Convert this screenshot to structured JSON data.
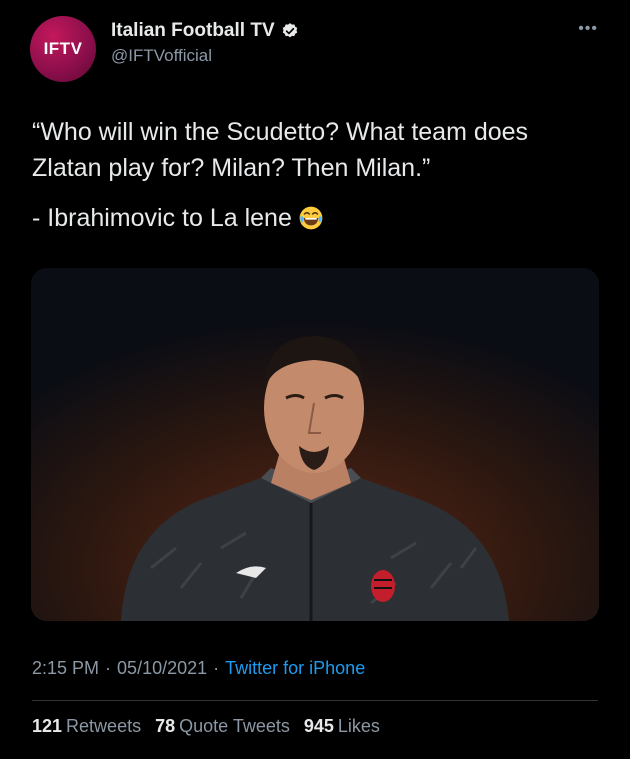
{
  "account": {
    "avatar_text": "IFTV",
    "display_name": "Italian Football TV",
    "handle": "@IFTVofficial",
    "verified_icon": "verified-badge",
    "more_icon": "more-dots"
  },
  "tweet": {
    "text_line1": "“Who will win the Scudetto? What team does Zlatan play for? Milan? Then Milan.”",
    "text_line2": "- Ibrahimovic to La lene",
    "emoji": "face-with-tears-of-joy"
  },
  "meta": {
    "time": "2:15 PM",
    "sep1": "·",
    "date": "05/10/2021",
    "sep2": "·",
    "source": "Twitter for iPhone"
  },
  "stats": {
    "retweets_count": "121",
    "retweets_label": "Retweets",
    "quotes_count": "78",
    "quotes_label": "Quote Tweets",
    "likes_count": "945",
    "likes_label": "Likes"
  },
  "colors": {
    "background": "#000000",
    "text": "#e7e9ea",
    "secondary": "#8b98a5",
    "link": "#1d9bf0",
    "avatar": "#a0124f"
  }
}
